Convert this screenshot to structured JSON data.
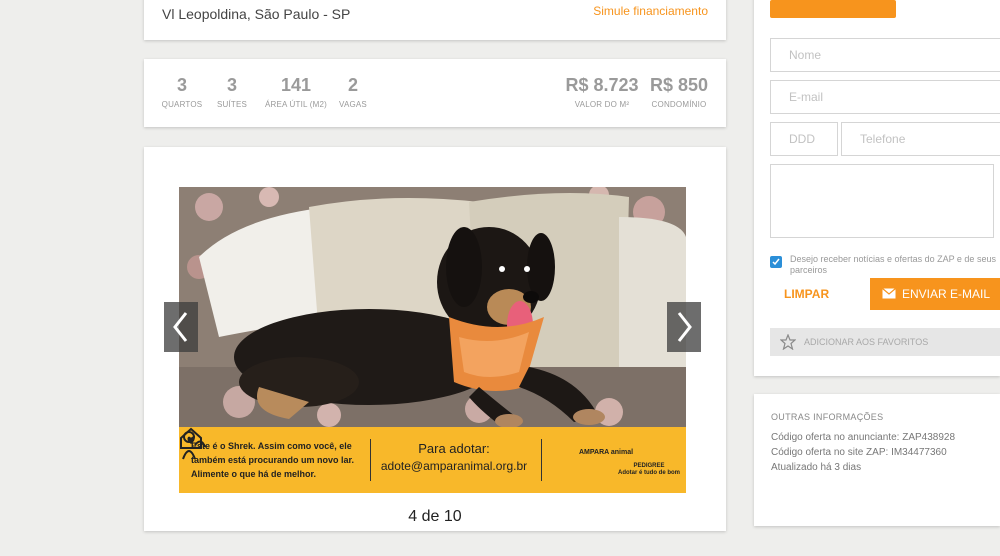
{
  "listing": {
    "address": "Vl Leopoldina, São Paulo - SP",
    "financing_link": "Simule financiamento"
  },
  "stats": [
    {
      "value": "3",
      "label": "QUARTOS"
    },
    {
      "value": "3",
      "label": "SUÍTES"
    },
    {
      "value": "141",
      "label": "ÁREA ÚTIL (M2)"
    },
    {
      "value": "2",
      "label": "VAGAS"
    },
    {
      "value": "R$ 8.723",
      "label": "VALOR DO M²"
    },
    {
      "value": "R$ 850",
      "label": "CONDOMÍNIO"
    }
  ],
  "gallery": {
    "counter": "4 de 10",
    "banner": {
      "left_text": "Este é o Shrek. Assim como você, ele também está procurando um novo lar. Alimente o que há de melhor.",
      "adopt_title": "Para adotar:",
      "adopt_email": "adote@amparanimal.org.br",
      "amparo_logo_text": "AMPARA animal",
      "pedigree_name": "PEDIGREE",
      "pedigree_tagline": "Adotar é tudo de bom"
    }
  },
  "contact_form": {
    "nome_placeholder": "Nome",
    "email_placeholder": "E-mail",
    "ddd_placeholder": "DDD",
    "telefone_placeholder": "Telefone",
    "newsletter_label": "Desejo receber notícias e ofertas do ZAP e de seus parceiros",
    "newsletter_checked": true,
    "clear_label": "LIMPAR",
    "send_label": "ENVIAR E-MAIL",
    "favorite_label": "ADICIONAR AOS FAVORITOS"
  },
  "other_info": {
    "title": "OUTRAS INFORMAÇÕES",
    "lines": [
      "Código oferta no anunciante: ZAP438928",
      "Código oferta no site ZAP: IM34477360",
      "Atualizado há 3 dias"
    ]
  },
  "colors": {
    "accent": "#f7941d",
    "banner": "#f8b82a",
    "checkbox": "#2b8fd8"
  }
}
